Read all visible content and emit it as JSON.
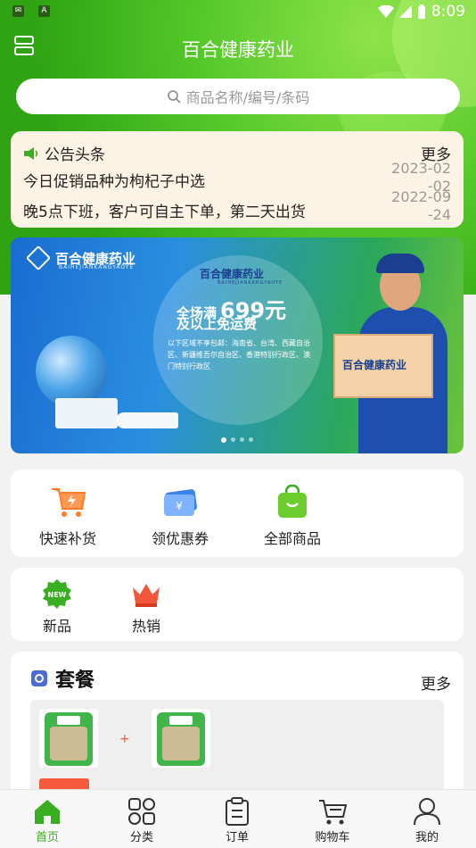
{
  "status_bar": {
    "time": "8:09"
  },
  "header": {
    "title": "百合健康药业"
  },
  "search": {
    "placeholder": "商品名称/编号/条码"
  },
  "notice": {
    "title": "公告头条",
    "more": "更多",
    "items": [
      {
        "text": "今日促销品种为枸杞子中选",
        "date": "2023-02-02"
      },
      {
        "text": "晚5点下班，客户可自主下单，第二天出货",
        "date": "2022-09-24"
      }
    ]
  },
  "banner": {
    "brand": "百合健康药业",
    "brand_en": "BAIHEJIANKANGYAOYE",
    "promo_prefix": "全场满",
    "promo_amount": "699元",
    "promo_line2": "及以上免运费",
    "areas_text": "以下区域不享包邮：海南省、台湾、西藏自治区、新疆维吾尔自治区、香港特别行政区、澳门特别行政区",
    "slide_count": 4,
    "active_slide": 1
  },
  "quick_actions": [
    {
      "label": "快速补货",
      "icon": "cart-lightning-icon"
    },
    {
      "label": "领优惠券",
      "icon": "coupon-icon"
    },
    {
      "label": "全部商品",
      "icon": "shopping-bag-icon"
    }
  ],
  "categories": [
    {
      "label": "新品",
      "icon": "new-badge-icon"
    },
    {
      "label": "热销",
      "icon": "crown-icon"
    }
  ],
  "combo": {
    "title": "套餐",
    "more": "更多"
  },
  "tabbar": [
    {
      "label": "首页",
      "icon": "home-icon",
      "active": true
    },
    {
      "label": "分类",
      "icon": "category-icon",
      "active": false
    },
    {
      "label": "订单",
      "icon": "order-icon",
      "active": false
    },
    {
      "label": "购物车",
      "icon": "cart-icon",
      "active": false
    },
    {
      "label": "我的",
      "icon": "user-icon",
      "active": false
    }
  ],
  "colors": {
    "brand_green": "#3aae22",
    "notice_bg": "#fdf3e4",
    "accent_red": "#f55b3c"
  }
}
